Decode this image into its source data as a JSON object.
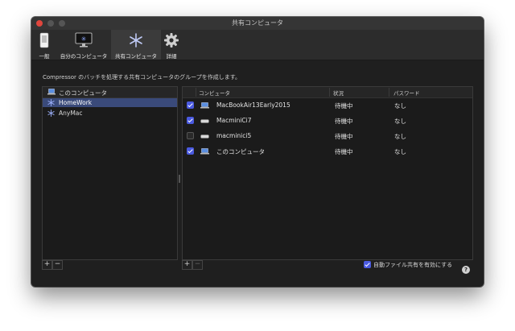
{
  "window": {
    "title": "共有コンピュータ"
  },
  "toolbar": {
    "items": [
      {
        "label": "一般",
        "icon": "phone-icon"
      },
      {
        "label": "自分のコンピュータ",
        "icon": "monitor-icon"
      },
      {
        "label": "共有コンピュータ",
        "icon": "snowflake-icon",
        "selected": true
      },
      {
        "label": "詳細",
        "icon": "gear-icon"
      }
    ]
  },
  "description": "Compressor のバッチを処理する共有コンピュータのグループを作成します。",
  "groups": {
    "items": [
      {
        "label": "このコンピュータ",
        "icon": "laptop-icon"
      },
      {
        "label": "HomeWork",
        "icon": "snowflake-icon",
        "selected": true
      },
      {
        "label": "AnyMac",
        "icon": "snowflake-icon"
      }
    ],
    "add_label": "+",
    "remove_label": "−"
  },
  "computers": {
    "columns": [
      "コンピュータ",
      "状況",
      "パスワード"
    ],
    "rows": [
      {
        "checked": true,
        "icon": "laptop-icon",
        "name": "MacBookAir13Early2015",
        "status": "待機中",
        "password": "なし"
      },
      {
        "checked": true,
        "icon": "mac-mini-icon",
        "name": "MacminiCi7",
        "status": "待機中",
        "password": "なし"
      },
      {
        "checked": false,
        "icon": "mac-mini-icon",
        "name": "macminici5",
        "status": "待機中",
        "password": "なし"
      },
      {
        "checked": true,
        "icon": "laptop-icon",
        "name": "このコンピュータ",
        "status": "待機中",
        "password": "なし"
      }
    ],
    "add_label": "+",
    "remove_label": "−",
    "auto_share_label": "自動ファイル共有を有効にする",
    "auto_share_checked": true
  },
  "help_label": "?",
  "colors": {
    "accent": "#4a5ae0",
    "selection": "#3a4a7a",
    "close": "#e0463d"
  }
}
